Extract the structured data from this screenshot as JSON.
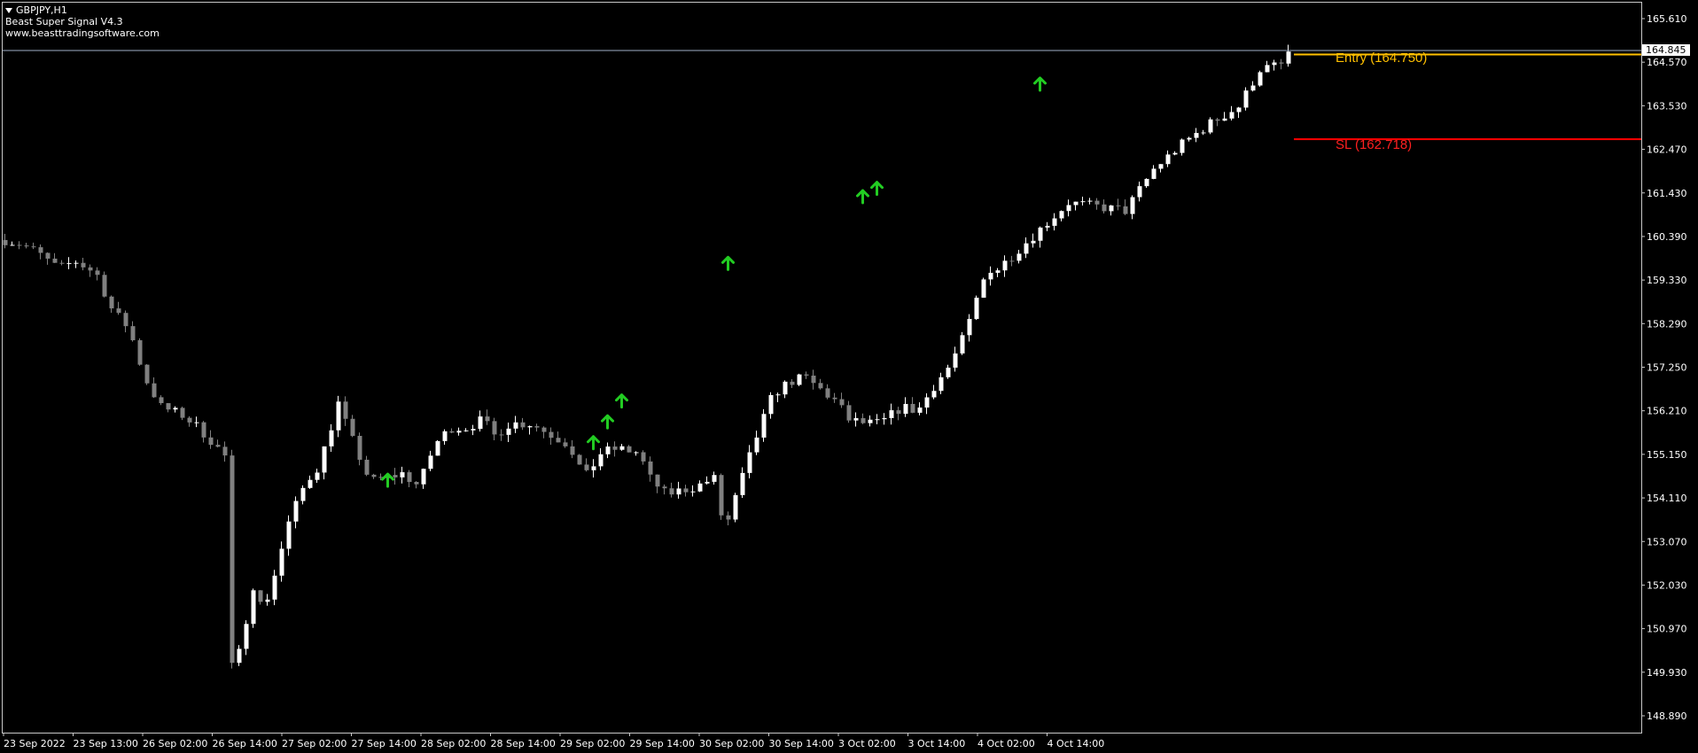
{
  "window": {
    "symbol_title": "GBPJPY,H1",
    "indicator_name": "Beast Super Signal V4.3",
    "website": "www.beasttradingsoftware.com",
    "menu_icon": "triangle-down-icon"
  },
  "trade_levels": {
    "entry_label": "Entry (164.750)",
    "entry_price": 164.75,
    "entry_color": "#ffc000",
    "sl_label": "SL (162.718)",
    "sl_price": 162.718,
    "sl_color": "#ff0000"
  },
  "current_price": {
    "label": "164.845",
    "value": 164.845
  },
  "colors": {
    "background": "#000000",
    "frame": "#c8c8c8",
    "bull_candle": "#ffffff",
    "bear_candle": "#808080",
    "arrow": "#22cc22"
  },
  "chart_data": {
    "type": "candlestick",
    "symbol": "GBPJPY",
    "timeframe": "H1",
    "ylim": [
      148.6,
      165.9
    ],
    "y_ticks": [
      "165.610",
      "164.570",
      "163.530",
      "162.470",
      "161.430",
      "160.390",
      "159.330",
      "158.290",
      "157.250",
      "156.210",
      "155.150",
      "154.110",
      "153.070",
      "152.030",
      "150.970",
      "149.930",
      "148.890"
    ],
    "x_ticks": [
      "23 Sep 2022",
      "23 Sep 13:00",
      "26 Sep 02:00",
      "26 Sep 14:00",
      "27 Sep 02:00",
      "27 Sep 14:00",
      "28 Sep 02:00",
      "28 Sep 14:00",
      "29 Sep 02:00",
      "29 Sep 14:00",
      "30 Sep 02:00",
      "30 Sep 14:00",
      "3 Oct 02:00",
      "3 Oct 14:00",
      "4 Oct 02:00",
      "4 Oct 14:00"
    ],
    "candle_count": 182,
    "close_path": [
      [
        0,
        160.3
      ],
      [
        3,
        160.2
      ],
      [
        6,
        160.0
      ],
      [
        10,
        159.6
      ],
      [
        13,
        159.8
      ],
      [
        17,
        159.5
      ],
      [
        20,
        158.6
      ],
      [
        23,
        158.2
      ],
      [
        26,
        157.0
      ],
      [
        29,
        156.3
      ],
      [
        33,
        156.1
      ],
      [
        36,
        155.8
      ],
      [
        39,
        155.4
      ],
      [
        41,
        155.1
      ],
      [
        42,
        150.0
      ],
      [
        44,
        150.5
      ],
      [
        46,
        152.1
      ],
      [
        48,
        151.4
      ],
      [
        50,
        152.2
      ],
      [
        53,
        153.6
      ],
      [
        56,
        154.5
      ],
      [
        58,
        154.8
      ],
      [
        60,
        155.5
      ],
      [
        62,
        156.4
      ],
      [
        64,
        155.7
      ],
      [
        66,
        155.1
      ],
      [
        68,
        154.5
      ],
      [
        71,
        154.6
      ],
      [
        74,
        154.7
      ],
      [
        77,
        154.4
      ],
      [
        80,
        155.4
      ],
      [
        83,
        155.8
      ],
      [
        86,
        155.8
      ],
      [
        89,
        156.0
      ],
      [
        91,
        155.6
      ],
      [
        94,
        155.9
      ],
      [
        98,
        155.9
      ],
      [
        102,
        155.6
      ],
      [
        105,
        155.4
      ],
      [
        108,
        154.6
      ],
      [
        111,
        155.2
      ],
      [
        114,
        155.3
      ],
      [
        118,
        155.2
      ],
      [
        120,
        154.6
      ],
      [
        123,
        154.2
      ],
      [
        126,
        154.3
      ],
      [
        129,
        154.4
      ],
      [
        132,
        154.6
      ],
      [
        134,
        153.3
      ],
      [
        137,
        154.5
      ],
      [
        140,
        155.6
      ],
      [
        143,
        156.6
      ],
      [
        146,
        156.9
      ],
      [
        149,
        157.0
      ],
      [
        152,
        156.7
      ],
      [
        155,
        156.4
      ],
      [
        157,
        156.0
      ],
      [
        160,
        155.9
      ],
      [
        163,
        155.9
      ],
      [
        165,
        156.1
      ],
      [
        167,
        156.3
      ],
      [
        170,
        156.2
      ],
      [
        173,
        156.8
      ],
      [
        176,
        157.3
      ],
      [
        179,
        158.1
      ],
      [
        182,
        159.3
      ],
      [
        185,
        159.9
      ],
      [
        188,
        160.3
      ],
      [
        191,
        160.9
      ],
      [
        194,
        161.5
      ],
      [
        197,
        161.3
      ],
      [
        200,
        161.0
      ],
      [
        202,
        160.4
      ],
      [
        205,
        160.7
      ],
      [
        208,
        160.9
      ],
      [
        210,
        161.4
      ],
      [
        212,
        160.1
      ],
      [
        214,
        159.9
      ],
      [
        216,
        160.4
      ],
      [
        218,
        161.1
      ],
      [
        221,
        161.6
      ],
      [
        224,
        161.7
      ],
      [
        227,
        161.8
      ],
      [
        230,
        161.5
      ],
      [
        233,
        161.3
      ],
      [
        236,
        161.2
      ],
      [
        239,
        161.1
      ]
    ],
    "signal_arrows": [
      {
        "time": "27 Sep ~16:00",
        "price": 154.9
      },
      {
        "time": "29 Sep ~10:00",
        "price": 155.8
      },
      {
        "time": "29 Sep ~12:00",
        "price": 156.3
      },
      {
        "time": "29 Sep ~16:00",
        "price": 156.8
      },
      {
        "time": "30 Sep ~08:00",
        "price": 160.1
      },
      {
        "time": "3 Oct ~04:00",
        "price": 161.7
      },
      {
        "time": "3 Oct ~08:00",
        "price": 161.9
      },
      {
        "time": "4 Oct ~14:00",
        "price": 164.4
      }
    ]
  }
}
